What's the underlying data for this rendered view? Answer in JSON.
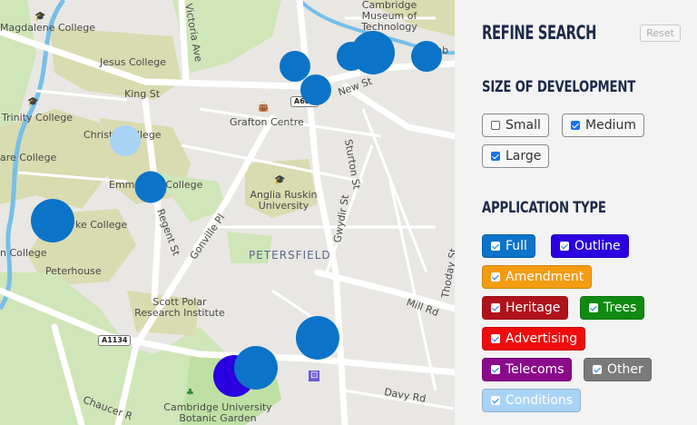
{
  "map": {
    "street_labels": [
      "Magdalene College",
      "Jesus College",
      "King St",
      "Trinity College",
      "Christ's College",
      "are College",
      "Emmanuel College",
      "ke College",
      "n College",
      "Peterhouse",
      "Grafton Centre",
      "Anglia Ruskin University",
      "PETERSFIELD",
      "Scott Polar Research Institute",
      "Cambridge University Botanic Garden",
      "Chaucer R",
      "Victoria Ave",
      "New St",
      "Regent St",
      "Gonville Pl",
      "Sturton St",
      "Gwydir St",
      "Mill Rd",
      "Thoday St",
      "Davy Rd",
      "Cambridge Museum of Technology",
      "Camb"
    ],
    "road_shields": [
      "A603",
      "A1134"
    ],
    "markers": [
      {
        "color": "#0b74c8"
      },
      {
        "color": "#0b74c8"
      },
      {
        "color": "#0b74c8"
      },
      {
        "color": "#0b74c8"
      },
      {
        "color": "#0b74c8"
      },
      {
        "color": "#a9d3f5"
      },
      {
        "color": "#a9d3f5"
      },
      {
        "color": "#0b74c8"
      },
      {
        "color": "#0b74c8"
      },
      {
        "color": "#0b74c8"
      },
      {
        "color": "#2a00e0"
      },
      {
        "color": "#0b74c8"
      }
    ]
  },
  "panel": {
    "title": "REFINE SEARCH",
    "reset_label": "Reset",
    "size_heading": "SIZE OF DEVELOPMENT",
    "sizes": [
      {
        "label": "Small",
        "checked": false
      },
      {
        "label": "Medium",
        "checked": true
      },
      {
        "label": "Large",
        "checked": true
      }
    ],
    "type_heading": "APPLICATION TYPE",
    "types": [
      {
        "label": "Full",
        "color": "#0b74c8",
        "checked": true
      },
      {
        "label": "Outline",
        "color": "#2a00e0",
        "checked": true
      },
      {
        "label": "Amendment",
        "color": "#f39c12",
        "checked": true
      },
      {
        "label": "Heritage",
        "color": "#b0121b",
        "checked": true
      },
      {
        "label": "Trees",
        "color": "#118a11",
        "checked": true
      },
      {
        "label": "Advertising",
        "color": "#ee0d0d",
        "checked": true
      },
      {
        "label": "Telecoms",
        "color": "#8b0a8b",
        "checked": true
      },
      {
        "label": "Other",
        "color": "#7a7a7a",
        "checked": true
      },
      {
        "label": "Conditions",
        "color": "#a9d3f5",
        "checked": true
      }
    ]
  }
}
